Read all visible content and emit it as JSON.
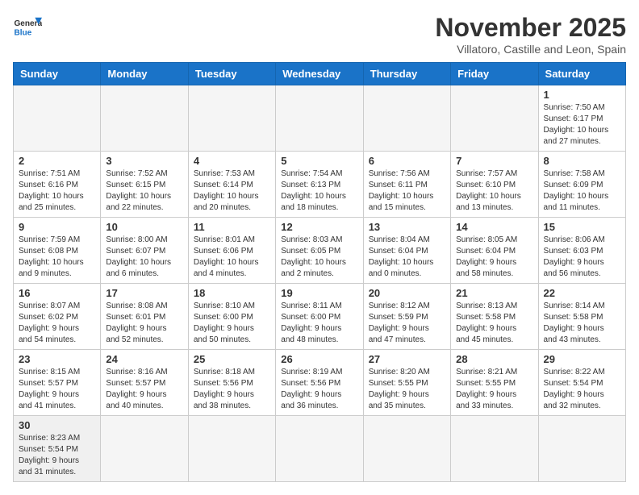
{
  "logo": {
    "text_general": "General",
    "text_blue": "Blue"
  },
  "title": "November 2025",
  "subtitle": "Villatoro, Castille and Leon, Spain",
  "weekdays": [
    "Sunday",
    "Monday",
    "Tuesday",
    "Wednesday",
    "Thursday",
    "Friday",
    "Saturday"
  ],
  "weeks": [
    [
      {
        "day": "",
        "info": ""
      },
      {
        "day": "",
        "info": ""
      },
      {
        "day": "",
        "info": ""
      },
      {
        "day": "",
        "info": ""
      },
      {
        "day": "",
        "info": ""
      },
      {
        "day": "",
        "info": ""
      },
      {
        "day": "1",
        "info": "Sunrise: 7:50 AM\nSunset: 6:17 PM\nDaylight: 10 hours\nand 27 minutes."
      }
    ],
    [
      {
        "day": "2",
        "info": "Sunrise: 7:51 AM\nSunset: 6:16 PM\nDaylight: 10 hours\nand 25 minutes."
      },
      {
        "day": "3",
        "info": "Sunrise: 7:52 AM\nSunset: 6:15 PM\nDaylight: 10 hours\nand 22 minutes."
      },
      {
        "day": "4",
        "info": "Sunrise: 7:53 AM\nSunset: 6:14 PM\nDaylight: 10 hours\nand 20 minutes."
      },
      {
        "day": "5",
        "info": "Sunrise: 7:54 AM\nSunset: 6:13 PM\nDaylight: 10 hours\nand 18 minutes."
      },
      {
        "day": "6",
        "info": "Sunrise: 7:56 AM\nSunset: 6:11 PM\nDaylight: 10 hours\nand 15 minutes."
      },
      {
        "day": "7",
        "info": "Sunrise: 7:57 AM\nSunset: 6:10 PM\nDaylight: 10 hours\nand 13 minutes."
      },
      {
        "day": "8",
        "info": "Sunrise: 7:58 AM\nSunset: 6:09 PM\nDaylight: 10 hours\nand 11 minutes."
      }
    ],
    [
      {
        "day": "9",
        "info": "Sunrise: 7:59 AM\nSunset: 6:08 PM\nDaylight: 10 hours\nand 9 minutes."
      },
      {
        "day": "10",
        "info": "Sunrise: 8:00 AM\nSunset: 6:07 PM\nDaylight: 10 hours\nand 6 minutes."
      },
      {
        "day": "11",
        "info": "Sunrise: 8:01 AM\nSunset: 6:06 PM\nDaylight: 10 hours\nand 4 minutes."
      },
      {
        "day": "12",
        "info": "Sunrise: 8:03 AM\nSunset: 6:05 PM\nDaylight: 10 hours\nand 2 minutes."
      },
      {
        "day": "13",
        "info": "Sunrise: 8:04 AM\nSunset: 6:04 PM\nDaylight: 10 hours\nand 0 minutes."
      },
      {
        "day": "14",
        "info": "Sunrise: 8:05 AM\nSunset: 6:04 PM\nDaylight: 9 hours\nand 58 minutes."
      },
      {
        "day": "15",
        "info": "Sunrise: 8:06 AM\nSunset: 6:03 PM\nDaylight: 9 hours\nand 56 minutes."
      }
    ],
    [
      {
        "day": "16",
        "info": "Sunrise: 8:07 AM\nSunset: 6:02 PM\nDaylight: 9 hours\nand 54 minutes."
      },
      {
        "day": "17",
        "info": "Sunrise: 8:08 AM\nSunset: 6:01 PM\nDaylight: 9 hours\nand 52 minutes."
      },
      {
        "day": "18",
        "info": "Sunrise: 8:10 AM\nSunset: 6:00 PM\nDaylight: 9 hours\nand 50 minutes."
      },
      {
        "day": "19",
        "info": "Sunrise: 8:11 AM\nSunset: 6:00 PM\nDaylight: 9 hours\nand 48 minutes."
      },
      {
        "day": "20",
        "info": "Sunrise: 8:12 AM\nSunset: 5:59 PM\nDaylight: 9 hours\nand 47 minutes."
      },
      {
        "day": "21",
        "info": "Sunrise: 8:13 AM\nSunset: 5:58 PM\nDaylight: 9 hours\nand 45 minutes."
      },
      {
        "day": "22",
        "info": "Sunrise: 8:14 AM\nSunset: 5:58 PM\nDaylight: 9 hours\nand 43 minutes."
      }
    ],
    [
      {
        "day": "23",
        "info": "Sunrise: 8:15 AM\nSunset: 5:57 PM\nDaylight: 9 hours\nand 41 minutes."
      },
      {
        "day": "24",
        "info": "Sunrise: 8:16 AM\nSunset: 5:57 PM\nDaylight: 9 hours\nand 40 minutes."
      },
      {
        "day": "25",
        "info": "Sunrise: 8:18 AM\nSunset: 5:56 PM\nDaylight: 9 hours\nand 38 minutes."
      },
      {
        "day": "26",
        "info": "Sunrise: 8:19 AM\nSunset: 5:56 PM\nDaylight: 9 hours\nand 36 minutes."
      },
      {
        "day": "27",
        "info": "Sunrise: 8:20 AM\nSunset: 5:55 PM\nDaylight: 9 hours\nand 35 minutes."
      },
      {
        "day": "28",
        "info": "Sunrise: 8:21 AM\nSunset: 5:55 PM\nDaylight: 9 hours\nand 33 minutes."
      },
      {
        "day": "29",
        "info": "Sunrise: 8:22 AM\nSunset: 5:54 PM\nDaylight: 9 hours\nand 32 minutes."
      }
    ],
    [
      {
        "day": "30",
        "info": "Sunrise: 8:23 AM\nSunset: 5:54 PM\nDaylight: 9 hours\nand 31 minutes."
      },
      {
        "day": "",
        "info": ""
      },
      {
        "day": "",
        "info": ""
      },
      {
        "day": "",
        "info": ""
      },
      {
        "day": "",
        "info": ""
      },
      {
        "day": "",
        "info": ""
      },
      {
        "day": "",
        "info": ""
      }
    ]
  ]
}
